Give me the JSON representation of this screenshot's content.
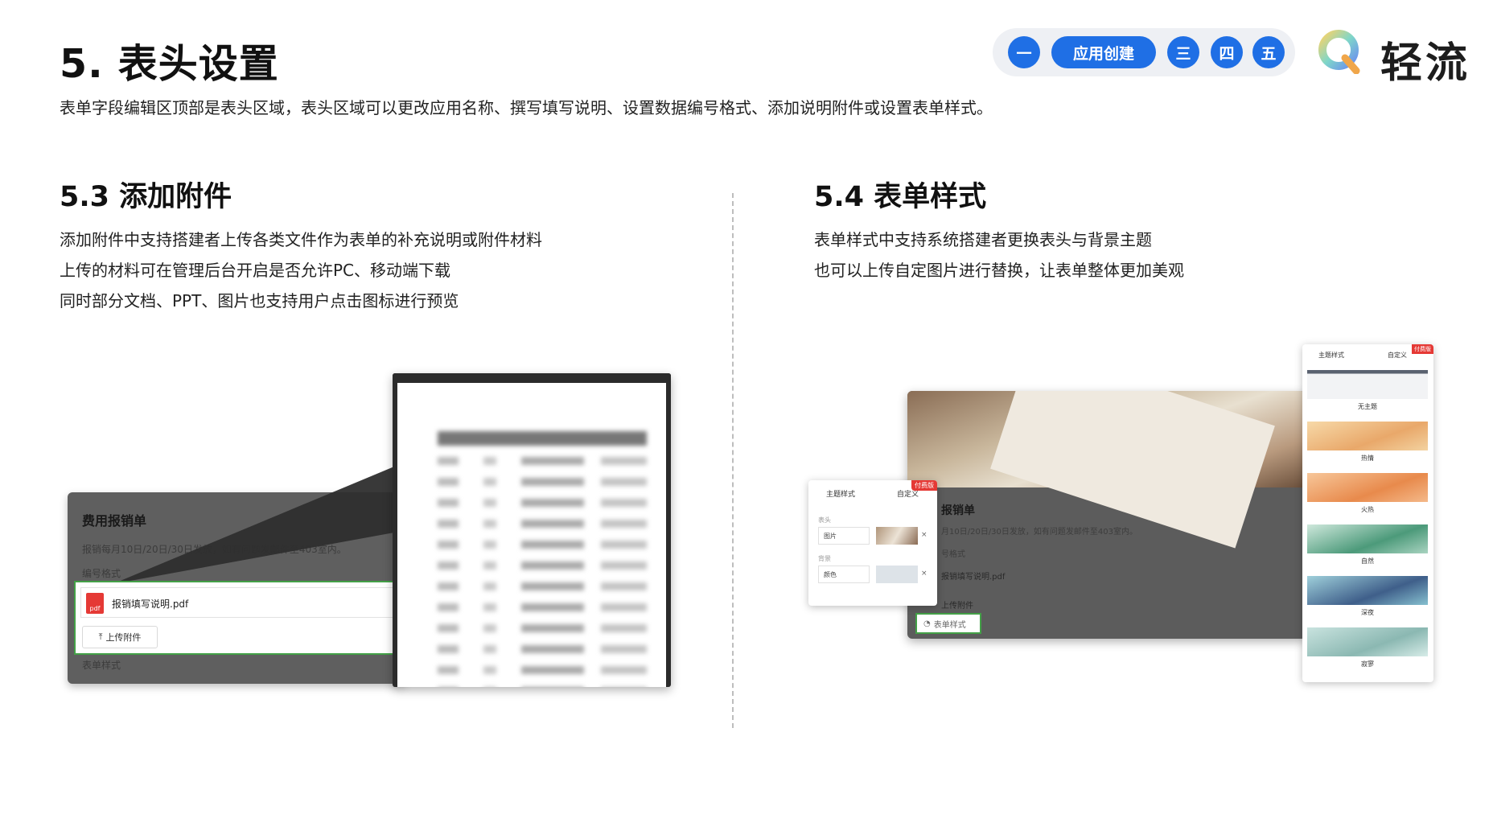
{
  "header": {
    "title": "5. 表头设置",
    "subtitle": "表单字段编辑区顶部是表头区域，表头区域可以更改应用名称、撰写填写说明、设置数据编号格式、添加说明附件或设置表单样式。"
  },
  "chapter_nav": {
    "items": [
      "一",
      "应用创建",
      "三",
      "四",
      "五"
    ],
    "accent_color": "#1f6fe5"
  },
  "logo": {
    "text": "轻流"
  },
  "section_left": {
    "title": "5.3 添加附件",
    "lines": [
      "添加附件中支持搭建者上传各类文件作为表单的补充说明或附件材料",
      "上传的材料可在管理后台开启是否允许PC、移动端下载",
      "同时部分文档、PPT、图片也支持用户点击图标进行预览"
    ],
    "mock": {
      "form_title": "费用报销单",
      "form_desc": "报销每月10日/20日/30日发放，如有问题发邮件至403室内。",
      "number_label": "编号格式",
      "file_name": "报销填写说明.pdf",
      "file_badge": "pdf",
      "upload_button": "上传附件",
      "style_label": "表单样式"
    }
  },
  "section_right": {
    "title": "5.4 表单样式",
    "lines": [
      "表单样式中支持系统搭建者更换表头与背景主题",
      "也可以上传自定图片进行替换，让表单整体更加美观"
    ],
    "mock": {
      "form_title": "报销单",
      "form_desc": "月10日/20日/30日发放，如有问题发邮件至403室内。",
      "number_label": "号格式",
      "file_name": "报销填写说明.pdf",
      "attach_label": "上传附件",
      "style_button": "表单样式",
      "style_panel": {
        "tab_theme": "主题样式",
        "tab_custom": "自定义",
        "ribbon": "付费版",
        "header_label": "表头",
        "header_select": "图片",
        "bg_label": "背景",
        "bg_select": "颜色"
      },
      "theme_panel": {
        "tab_theme": "主题样式",
        "tab_custom": "自定义",
        "ribbon": "付费版",
        "themes": [
          "无主题",
          "热情",
          "火热",
          "自然",
          "深夜",
          "寂寥"
        ]
      }
    }
  }
}
